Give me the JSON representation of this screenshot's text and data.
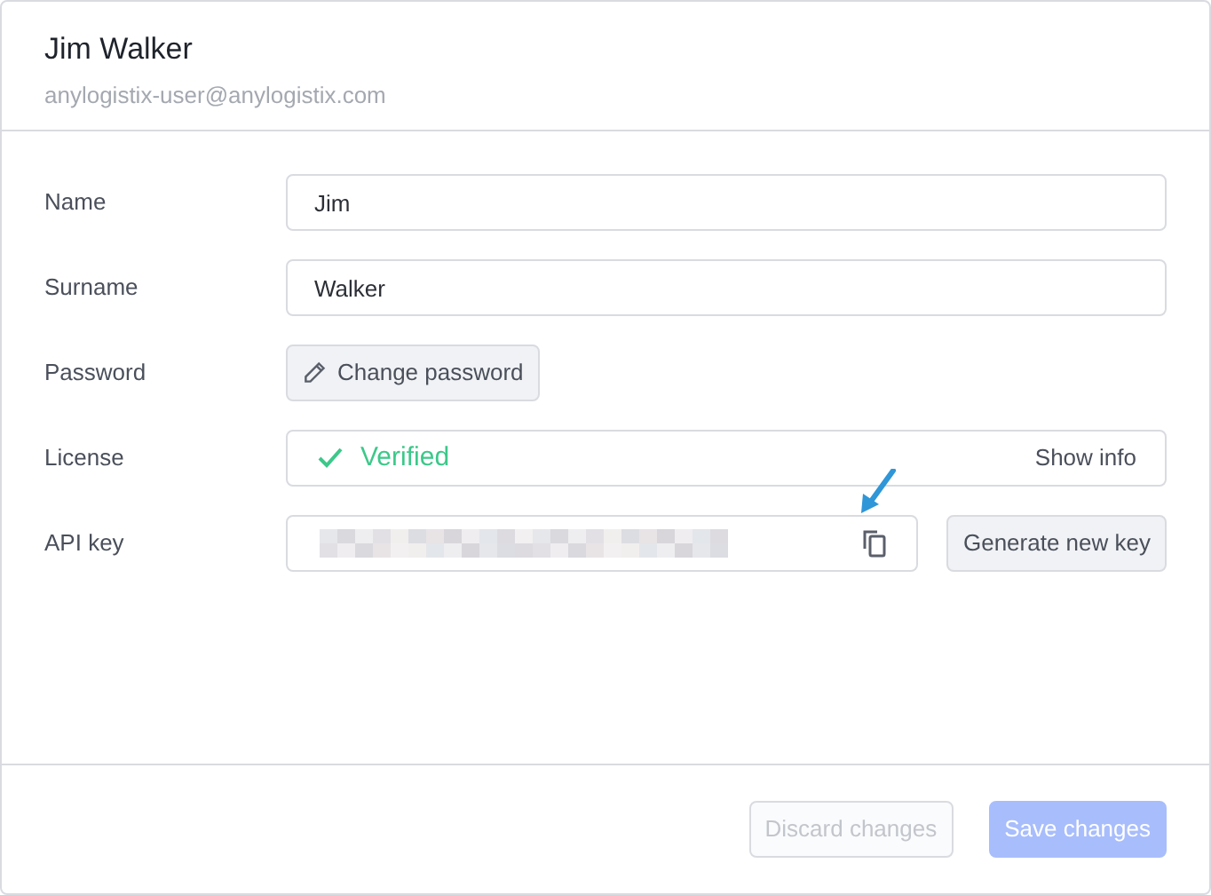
{
  "header": {
    "title": "Jim Walker",
    "email": "anylogistix-user@anylogistix.com"
  },
  "fields": [
    {
      "kind": "text",
      "label": "Name",
      "value": "Jim"
    },
    {
      "kind": "text",
      "label": "Surname",
      "value": "Walker"
    },
    {
      "kind": "action",
      "label": "Password",
      "button": "Change password"
    },
    {
      "kind": "license",
      "label": "License",
      "status": "Verified",
      "verified": true,
      "link": "Show info"
    },
    {
      "kind": "apikey",
      "label": "API key",
      "button": "Generate new key",
      "hidden": true
    }
  ],
  "footer": {
    "buttons": [
      {
        "label": "Discard changes",
        "kind": "secondary",
        "disabled": true
      },
      {
        "label": "Save changes",
        "kind": "primary",
        "disabled": true
      }
    ]
  }
}
